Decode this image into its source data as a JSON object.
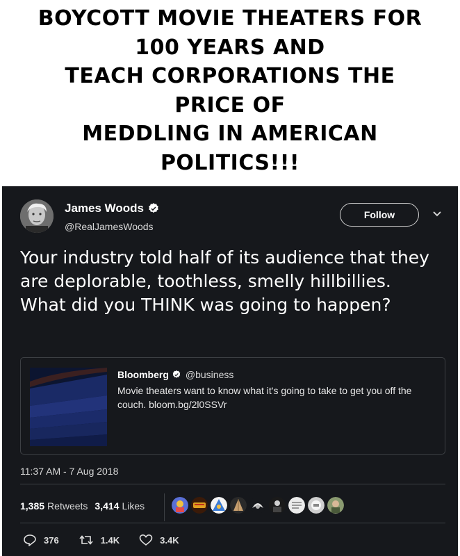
{
  "headline": {
    "lines": [
      "BOYCOTT MOVIE THEATERS FOR",
      "100 YEARS AND",
      "TEACH CORPORATIONS THE",
      "PRICE OF",
      "MEDDLING IN AMERICAN",
      "POLITICS!!!"
    ]
  },
  "tweet": {
    "author_name": "James Woods",
    "author_handle": "@RealJamesWoods",
    "follow_label": "Follow",
    "text": "Your industry told half of its audience that they are deplorable, toothless, smelly hillbillies. What did you THINK was going to happen?",
    "timestamp": "11:37 AM - 7 Aug 2018",
    "retweets_count": "1,385",
    "retweets_label": "Retweets",
    "likes_count": "3,414",
    "likes_label": "Likes",
    "reply_count": "376",
    "retweet_action_count": "1.4K",
    "like_action_count": "3.4K"
  },
  "quote": {
    "name": "Bloomberg",
    "handle": "@business",
    "text": "Movie theaters want to know what it's going to take to get you off the couch. bloom.bg/2l0SSVr"
  },
  "icons": {
    "verified": "verified-badge-icon",
    "chevron": "chevron-down-icon",
    "reply": "reply-icon",
    "retweet": "retweet-icon",
    "like": "heart-icon"
  },
  "colors": {
    "tweet_background": "#16181c",
    "border": "#3d4044",
    "text_primary": "#ffffff",
    "text_secondary": "#d8d8d8"
  }
}
